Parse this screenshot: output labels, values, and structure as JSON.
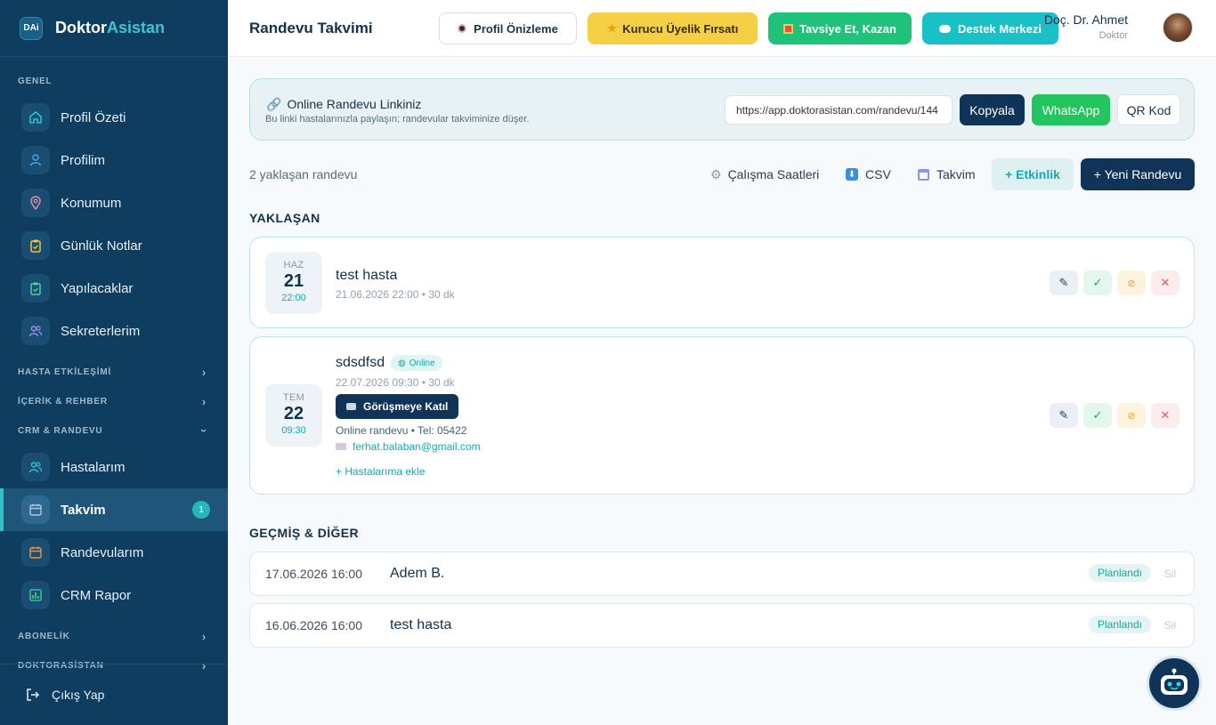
{
  "brand": {
    "logo_text": "DAi",
    "name_part1": "Doktor",
    "name_part2": "Asistan"
  },
  "sidebar": {
    "sections": [
      {
        "label": "GENEL"
      },
      {
        "label": "HASTA ETKİLEŞİMİ"
      },
      {
        "label": "İÇERİK & REHBER"
      },
      {
        "label": "CRM & RANDEVU"
      },
      {
        "label": "ABONELİK"
      },
      {
        "label": "DOKTORASİSTAN"
      }
    ],
    "items": [
      {
        "label": "Profil Özeti",
        "icon": "home-icon",
        "color": "#2ec4c6"
      },
      {
        "label": "Profilim",
        "icon": "user-icon",
        "color": "#3fa9e8"
      },
      {
        "label": "Konumum",
        "icon": "location-pin-icon",
        "color": "#e48aa8"
      },
      {
        "label": "Günlük Notlar",
        "icon": "clipboard-icon",
        "color": "#f0c63a"
      },
      {
        "label": "Yapılacaklar",
        "icon": "checklist-icon",
        "color": "#46d49a"
      },
      {
        "label": "Sekreterlerim",
        "icon": "users-icon",
        "color": "#a58cf0"
      },
      {
        "label": "Hastalarım",
        "icon": "patients-icon",
        "color": "#2ec4c6"
      },
      {
        "label": "Takvim",
        "icon": "calendar-icon",
        "color": "#b9c7d4",
        "badge": "1"
      },
      {
        "label": "Randevularım",
        "icon": "appointment-calendar-icon",
        "color": "#f0923a"
      },
      {
        "label": "CRM Rapor",
        "icon": "bar-chart-icon",
        "color": "#46d49a"
      }
    ],
    "logout": "Çıkış Yap"
  },
  "header": {
    "title": "Randevu Takvimi",
    "profile_preview": "Profil Önizleme",
    "founder": "Kurucu Üyelik Fırsatı",
    "refer": "Tavsiye Et, Kazan",
    "support": "Destek Merkezi",
    "user_name": "Doç. Dr. Ahmet",
    "user_role": "Doktor"
  },
  "link_card": {
    "title": "Online Randevu Linkiniz",
    "subtitle": "Bu linki hastalarınızla paylaşın; randevular takviminize düşer.",
    "url": "https://app.doktorasistan.com/randevu/144",
    "copy": "Kopyala",
    "whatsapp": "WhatsApp",
    "qr": "QR Kod"
  },
  "toolbar": {
    "count_text": "2 yaklaşan randevu",
    "working_hours": "Çalışma Saatleri",
    "csv": "CSV",
    "calendar": "Takvim",
    "event": "+ Etkinlik",
    "new_appt": "+ Yeni Randevu"
  },
  "upcoming": {
    "title": "YAKLAŞAN",
    "items": [
      {
        "month": "HAZ",
        "day": "21",
        "time": "22:00",
        "name": "test hasta",
        "meta": "21.06.2026 22:00 • 30 dk"
      },
      {
        "month": "TEM",
        "day": "22",
        "time": "09:30",
        "name": "sdsdfsd",
        "online_badge": "Online",
        "meta": "22.07.2026 09:30 • 30 dk",
        "join": "Görüşmeye Katıl",
        "note": "Online randevu • Tel: 05422",
        "email": "ferhat.balaban@gmail.com",
        "add_link": "+ Hastalarıma ekle"
      }
    ]
  },
  "history": {
    "title": "GEÇMİŞ & DİĞER",
    "items": [
      {
        "datetime": "17.06.2026 16:00",
        "name": "Adem B.",
        "status": "Planlandı",
        "delete": "Sil"
      },
      {
        "datetime": "16.06.2026 16:00",
        "name": "test hasta",
        "status": "Planlandı",
        "delete": "Sil"
      }
    ]
  }
}
